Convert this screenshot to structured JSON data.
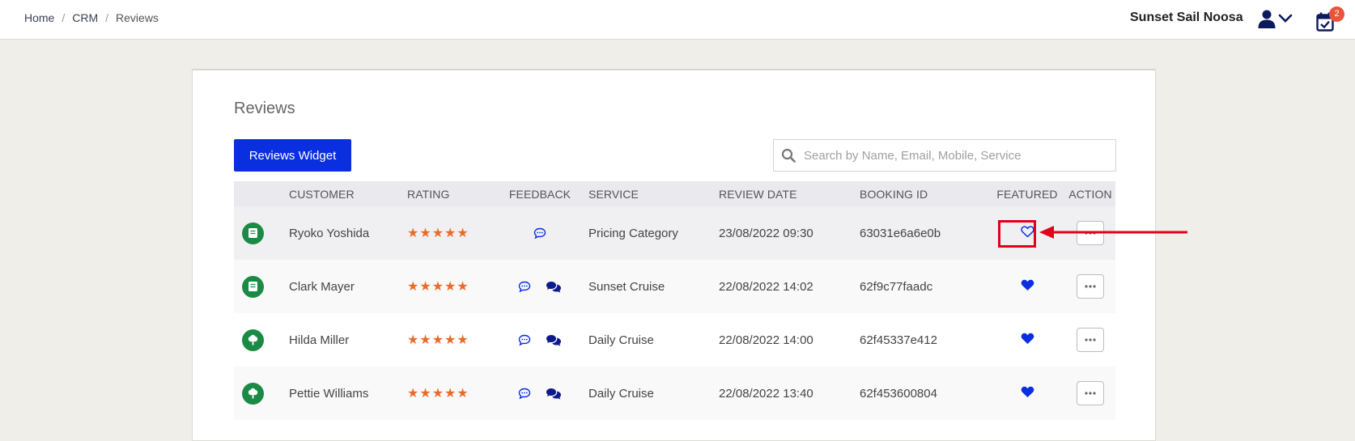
{
  "breadcrumb": [
    "Home",
    "CRM",
    "Reviews"
  ],
  "breadcrumb_separator": "/",
  "header": {
    "company": "Sunset Sail Noosa",
    "notification_count": "2"
  },
  "page": {
    "title": "Reviews",
    "widget_button": "Reviews Widget",
    "search_placeholder": "Search by Name, Email, Mobile, Service"
  },
  "table": {
    "columns": [
      "",
      "CUSTOMER",
      "RATING",
      "FEEDBACK",
      "SERVICE",
      "REVIEW DATE",
      "BOOKING ID",
      "FEATURED",
      "ACTION"
    ],
    "rows": [
      {
        "source_icon": "book-icon",
        "customer": "Ryoko Yoshida",
        "rating": "★★★★★",
        "feedback": [
          "comment-icon"
        ],
        "service": "Pricing Category",
        "review_date": "23/08/2022 09:30",
        "booking_id": "63031e6a6e0b",
        "featured": "heart-outline-icon"
      },
      {
        "source_icon": "book-icon",
        "customer": "Clark Mayer",
        "rating": "★★★★★",
        "feedback": [
          "comment-icon",
          "comments-reply-icon"
        ],
        "service": "Sunset Cruise",
        "review_date": "22/08/2022 14:02",
        "booking_id": "62f9c77faadc",
        "featured": "heart-filled-icon"
      },
      {
        "source_icon": "tree-icon",
        "customer": "Hilda Miller",
        "rating": "★★★★★",
        "feedback": [
          "comment-icon",
          "comments-reply-icon"
        ],
        "service": "Daily Cruise",
        "review_date": "22/08/2022 14:00",
        "booking_id": "62f45337e412",
        "featured": "heart-filled-icon"
      },
      {
        "source_icon": "tree-icon",
        "customer": "Pettie Williams",
        "rating": "★★★★★",
        "feedback": [
          "comment-icon",
          "comments-reply-icon"
        ],
        "service": "Daily Cruise",
        "review_date": "22/08/2022 13:40",
        "booking_id": "62f453600804",
        "featured": "heart-filled-icon"
      }
    ]
  },
  "colors": {
    "primary": "#0a2fe0",
    "source_green": "#1a8a45",
    "stars": "#e96b28",
    "badge": "#e8553a",
    "annotation": "#e2001a"
  }
}
